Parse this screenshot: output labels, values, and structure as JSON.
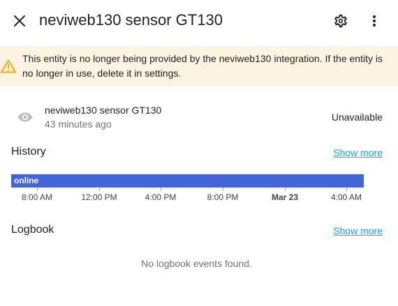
{
  "dialog": {
    "title": "neviweb130 sensor GT130"
  },
  "alert": {
    "message": "This entity is no longer being provided by the neviweb130 integration. If the entity is no longer in use, delete it in settings."
  },
  "entity": {
    "name": "neviweb130 sensor GT130",
    "last_changed": "43 minutes ago",
    "state": "Unavailable"
  },
  "history": {
    "title": "History",
    "show_more": "Show more",
    "timeline": {
      "state": "online",
      "color": "#4365d6"
    },
    "ticks": [
      "8:00 AM",
      "12:00 PM",
      "4:00 PM",
      "8:00 PM",
      "Mar 23",
      "4:00 AM"
    ]
  },
  "logbook": {
    "title": "Logbook",
    "show_more": "Show more",
    "empty_message": "No logbook events found."
  },
  "colors": {
    "accent": "#03a9f4",
    "warning": "#ffa600",
    "warning_bg": "#fdf3e3",
    "timeline": "#4365d6"
  }
}
